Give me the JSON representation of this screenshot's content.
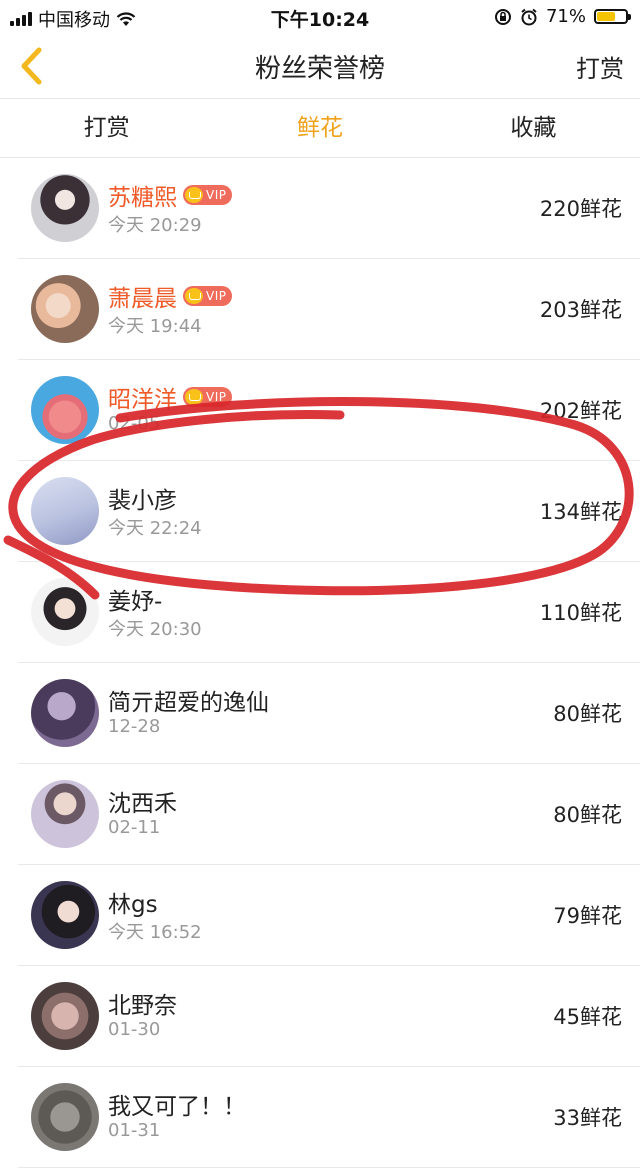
{
  "status_bar": {
    "carrier": "中国移动",
    "time": "下午10:24",
    "battery": "71%",
    "battery_level": 0.71
  },
  "nav": {
    "title": "粉丝荣誉榜",
    "right_action": "打赏"
  },
  "tabs": [
    {
      "label": "打赏",
      "active": false
    },
    {
      "label": "鲜花",
      "active": true
    },
    {
      "label": "收藏",
      "active": false
    }
  ],
  "colors": {
    "accent": "#f0a21c",
    "vip_name": "#ef5a28",
    "vip_badge": "#ef6b5b",
    "marker": "#d8262a"
  },
  "vip_label": "VIP",
  "fans": [
    {
      "name": "苏糖熙",
      "vip": true,
      "time": "今天 20:29",
      "count": "220鲜花"
    },
    {
      "name": "萧晨晨",
      "vip": true,
      "time": "今天 19:44",
      "count": "203鲜花"
    },
    {
      "name": "昭洋洋",
      "vip": true,
      "time": "02-05",
      "count": "202鲜花"
    },
    {
      "name": "裴小彦",
      "vip": false,
      "time": "今天 22:24",
      "count": "134鲜花"
    },
    {
      "name": "姜妤-",
      "vip": false,
      "time": "今天 20:30",
      "count": "110鲜花"
    },
    {
      "name": "简亓超爱的逸仙",
      "vip": false,
      "time": "12-28",
      "count": "80鲜花"
    },
    {
      "name": "沈西禾",
      "vip": false,
      "time": "02-11",
      "count": "80鲜花"
    },
    {
      "name": "林gs",
      "vip": false,
      "time": "今天 16:52",
      "count": "79鲜花"
    },
    {
      "name": "北野奈",
      "vip": false,
      "time": "01-30",
      "count": "45鲜花"
    },
    {
      "name": "我又可了！！",
      "vip": false,
      "time": "01-31",
      "count": "33鲜花"
    }
  ]
}
